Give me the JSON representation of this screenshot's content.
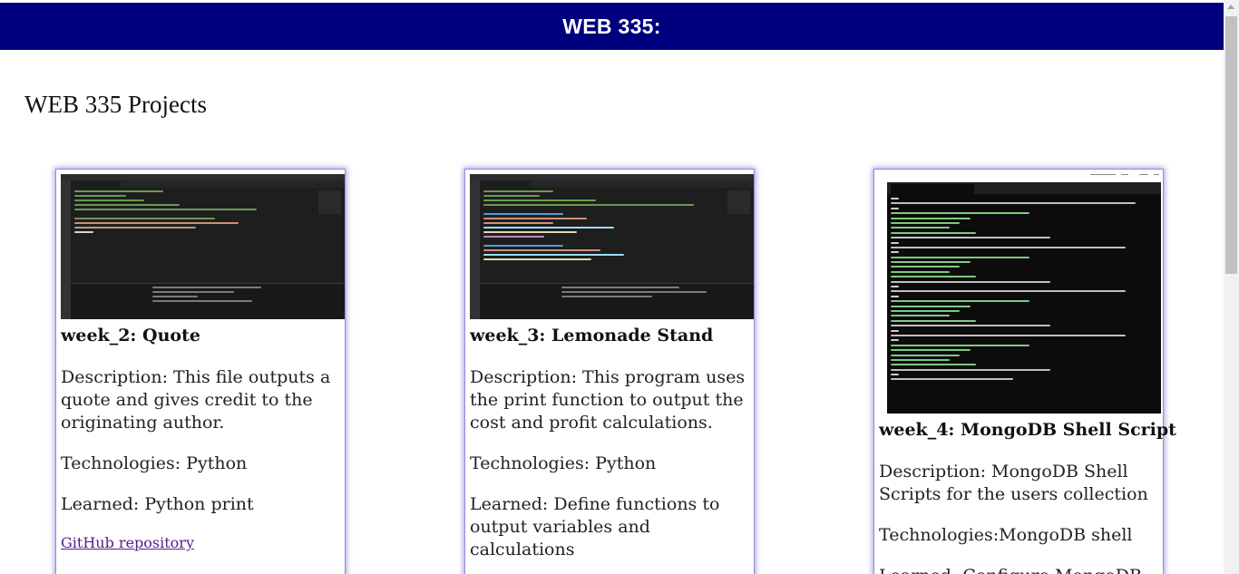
{
  "header": {
    "title": "WEB 335:",
    "background": "#00007f"
  },
  "main": {
    "heading": "WEB 335 Projects"
  },
  "projects": [
    {
      "title": "week_2: Quote",
      "description": "Description: This file outputs a quote and gives credit to the originating author.",
      "technologies": "Technologies: Python",
      "learned": "Learned: Python print",
      "link_label": "GitHub repository",
      "thumbnail": "vscode-editor-screenshot"
    },
    {
      "title": "week_3: Lemonade Stand",
      "description": "Description: This program uses the print function to output the cost and profit calculations.",
      "technologies": "Technologies: Python",
      "learned": "Learned: Define functions to output variables and calculations",
      "thumbnail": "vscode-editor-screenshot"
    },
    {
      "title": "week_4: MongoDB Shell Script",
      "description": "Description: MongoDB Shell Scripts for the users collection",
      "technologies": "Technologies:MongoDB shell",
      "learned": "Learned: Configure MongoDB",
      "thumbnail": "mongosh-terminal-screenshot"
    }
  ],
  "colors": {
    "card_border": "#8f8fd8",
    "link": "#551a8b"
  }
}
